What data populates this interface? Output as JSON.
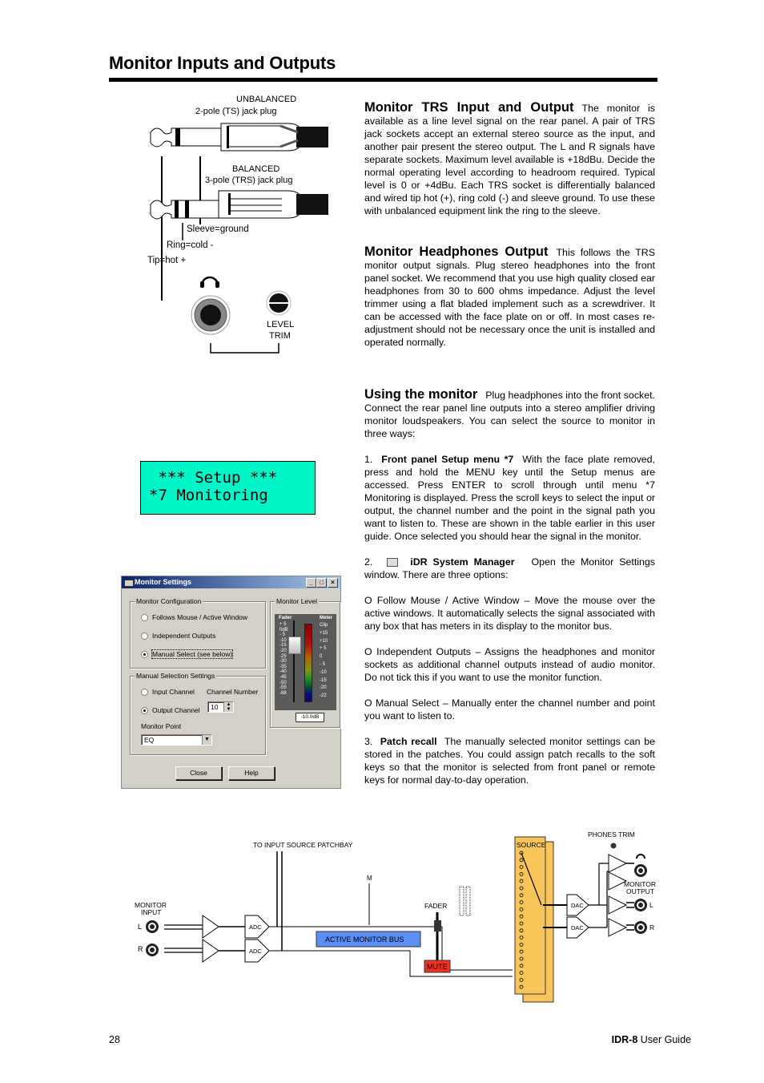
{
  "page": {
    "title": "Monitor Inputs and Outputs",
    "page_number": "28",
    "footer_product": "IDR-8",
    "footer_suffix": " User Guide"
  },
  "jack_diagram": {
    "unbalanced_title": "UNBALANCED",
    "unbalanced_sub": "2-pole (TS) jack plug",
    "balanced_title": "BALANCED",
    "balanced_sub": "3-pole (TRS) jack plug",
    "sleeve_label": "Sleeve=ground",
    "ring_label": "Ring=cold -",
    "tip_label": "Tip=hot +",
    "level_trim_line1": "LEVEL",
    "level_trim_line2": "TRIM"
  },
  "sections": {
    "trs": {
      "heading": "Monitor TRS Input and Output",
      "body": "The monitor is available as a line level signal on the rear panel.  A pair of TRS jack sockets accept an external stereo source as the input, and another pair present the stereo output.  The L and R signals have separate sockets.  Maximum level available is +18dBu.  Decide the normal operating level according to headroom required.  Typical level is 0 or +4dBu.  Each TRS socket is differentially balanced and wired tip hot (+), ring cold (-) and sleeve ground.  To use these with unbalanced equipment link the ring to the sleeve."
    },
    "headphones": {
      "heading": "Monitor Headphones Output",
      "body": "This follows the TRS monitor output signals.  Plug stereo headphones into the front panel socket.  We recommend that you use high quality closed ear headphones from 30 to 600 ohms impedance.  Adjust the level trimmer using a flat bladed implement such as a screwdriver.  It can be accessed with the face plate on or off.  In most cases re-adjustment should not be necessary once the unit is installed and operated normally."
    },
    "using": {
      "heading": "Using the monitor",
      "body": "Plug headphones into the front socket.  Connect the rear panel line outputs into a stereo amplifier driving monitor loudspeakers.  You can select the source to monitor in three ways:",
      "step1_num": "1.",
      "step1_title": "Front panel Setup menu *7",
      "step1_body": "With the face plate removed, press and hold the MENU key until the Setup menus are accessed.  Press ENTER to scroll through until menu *7 Monitoring is displayed.  Press the scroll keys to select the input or output, the channel number and the point in the signal path you want to listen to.  These are shown in the table earlier in this user guide.  Once selected you should hear the signal in the monitor.",
      "step2_num": "2.",
      "step2_title": "iDR System Manager",
      "step2_body": "Open the Monitor Settings window.  There are three options:",
      "option1": "O   Follow Mouse / Active Window – Move the mouse over the active windows.  It automatically selects the signal associated with any box that has meters in its display to the monitor bus.",
      "option2": "O   Independent Outputs – Assigns the headphones and monitor sockets as additional channel outputs instead of audio monitor.  Do not tick this if you want to use the monitor function.",
      "option3": "O   Manual Select – Manually enter the channel number and point you want to listen to.",
      "step3_num": "3.",
      "step3_title": "Patch recall",
      "step3_body": "The manually selected monitor settings can be stored in the patches.  You could assign patch recalls to the soft keys so that the monitor is selected from front panel or remote keys for normal day-to-day operation."
    }
  },
  "lcd": {
    "line1": " *** Setup ***",
    "line2": "*7 Monitoring",
    "color": "#00f5c8"
  },
  "dialog": {
    "title": "Monitor Settings",
    "minimize": "_",
    "maximize": "□",
    "close": "×",
    "config_group": "Monitor Configuration",
    "options": [
      {
        "label": "Follows Mouse / Active Window",
        "selected": false
      },
      {
        "label": "Independent Outputs",
        "selected": false
      },
      {
        "label": "Manual Select (see below)",
        "selected": true
      }
    ],
    "manual_group": "Manual Selection Settings",
    "input_channel": "Input Channel",
    "output_channel": "Output Channel",
    "channel_number_label": "Channel Number",
    "channel_number_value": "10",
    "monitor_point_label": "Monitor Point",
    "monitor_point_value": "EQ",
    "level_group": "Monitor Level",
    "fader_label": "Fader",
    "meter_label": "Meter",
    "fader_scale": [
      "+ 5",
      "0dB",
      "- 5",
      "-10",
      "-15",
      "-20",
      "-25",
      "-30",
      "-35",
      "-40",
      "-45",
      "-50",
      "-55",
      "-88"
    ],
    "meter_scale": [
      "Clip",
      "+15",
      "+10",
      "+ 5",
      "0",
      "- 5",
      "-10",
      "-15",
      "-20",
      "-22"
    ],
    "level_readout": "-10.0dB",
    "close_button": "Close",
    "help_button": "Help"
  },
  "signal_diagram": {
    "patchbay_label": "TO INPUT SOURCE PATCHBAY",
    "monitor_input_line1": "MONITOR",
    "monitor_input_line2": "INPUT",
    "left": "L",
    "right": "R",
    "adc": "ADC",
    "dac": "DAC",
    "m_label": "M",
    "fader_label": "FADER",
    "bus_label": "ACTIVE MONITOR BUS",
    "mute_label": "MUTE",
    "source_label": "SOURCE",
    "phones_trim": "PHONES TRIM",
    "monitor_output_line1": "MONITOR",
    "monitor_output_line2": "OUTPUT",
    "bus_color": "#5b8ef0",
    "mute_color": "#ee3322",
    "source_color": "#f8c55a"
  }
}
